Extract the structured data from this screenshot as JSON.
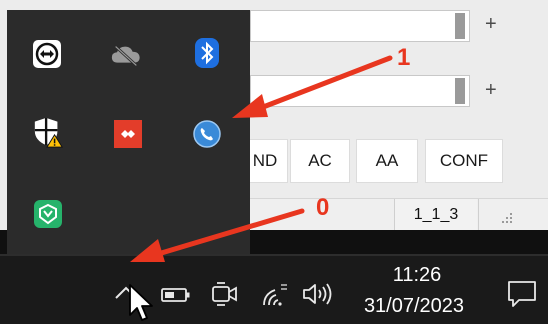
{
  "app": {
    "buttons": [
      "ND",
      "AC",
      "AA",
      "CONF"
    ],
    "plus_label": "+",
    "status_text": "1_1_3"
  },
  "tray": {
    "icons": [
      {
        "name": "teamviewer-icon"
      },
      {
        "name": "onedrive-offline-icon"
      },
      {
        "name": "bluetooth-icon"
      },
      {
        "name": "windows-security-warning-icon"
      },
      {
        "name": "anydesk-icon"
      },
      {
        "name": "phone-app-icon"
      },
      {
        "name": "sophos-icon"
      }
    ]
  },
  "taskbar": {
    "time": "11:26",
    "date": "31/07/2023",
    "icons": [
      "chevron-up-icon",
      "battery-icon",
      "camera-icon",
      "wifi-icon",
      "volume-icon",
      "notification-icon"
    ]
  },
  "annotations": {
    "label_one": "1",
    "label_zero": "0",
    "arrow_color": "#e8361f"
  },
  "colors": {
    "taskbar_bg": "#1a1a1a",
    "tray_bg": "#2b2b2b",
    "bluetooth_blue": "#1e6fe0"
  }
}
